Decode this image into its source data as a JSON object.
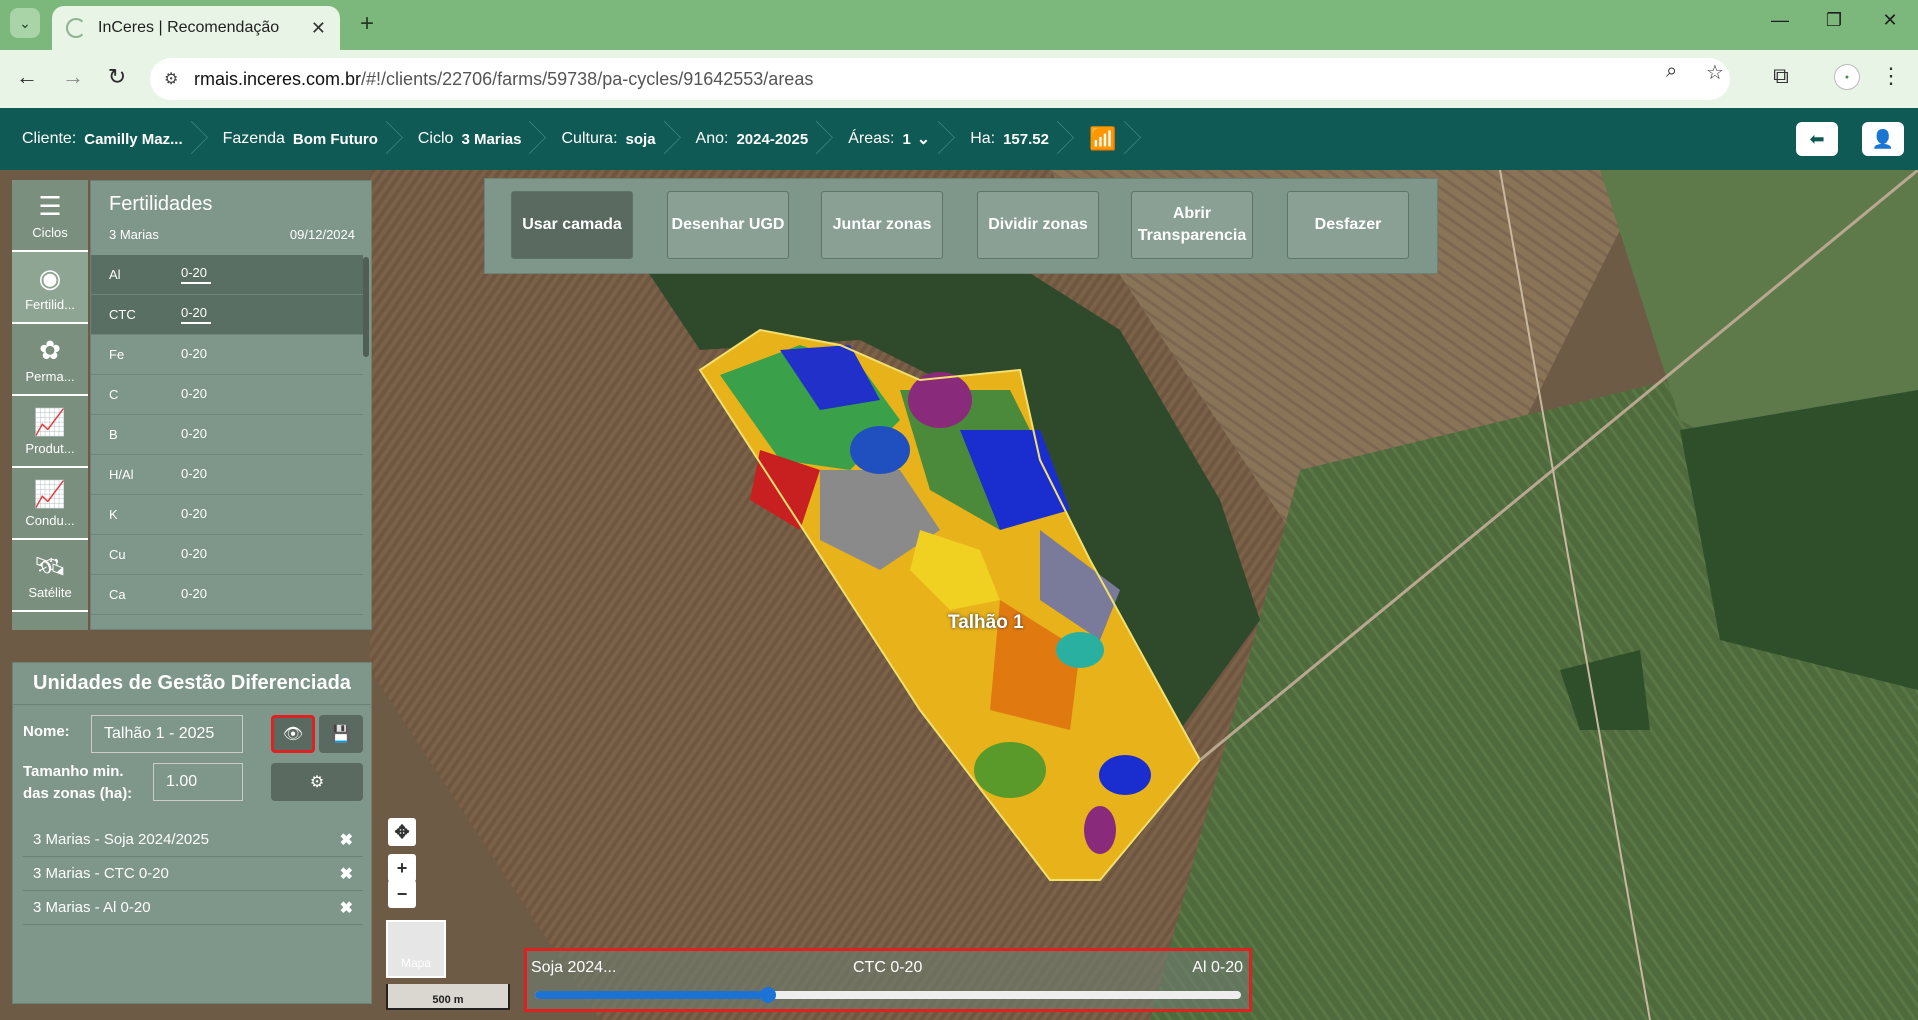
{
  "browser": {
    "tab_title": "InCeres | Recomendação",
    "url_domain": "rmais.inceres.com.br",
    "url_path": "/#!/clients/22706/farms/59738/pa-cycles/91642553/areas"
  },
  "header": {
    "cliente_label": "Cliente:",
    "cliente_value": "Camilly Maz...",
    "fazenda_label": "Fazenda",
    "fazenda_value": "Bom Futuro",
    "ciclo_label": "Ciclo",
    "ciclo_value": "3 Marias",
    "cultura_label": "Cultura:",
    "cultura_value": "soja",
    "ano_label": "Ano:",
    "ano_value": "2024-2025",
    "areas_label": "Áreas:",
    "areas_value": "1",
    "ha_label": "Ha:",
    "ha_value": "157.52"
  },
  "tools": [
    {
      "label": "Ciclos"
    },
    {
      "label": "Fertilid..."
    },
    {
      "label": "Perma..."
    },
    {
      "label": "Produt..."
    },
    {
      "label": "Condu..."
    },
    {
      "label": "Satélite"
    }
  ],
  "fertilidades": {
    "title": "Fertilidades",
    "subtitle": "3 Marias",
    "date": "09/12/2024",
    "rows": [
      {
        "key": "Al",
        "value": "0-20",
        "selected": true
      },
      {
        "key": "CTC",
        "value": "0-20",
        "selected": true
      },
      {
        "key": "Fe",
        "value": "0-20",
        "selected": false
      },
      {
        "key": "C",
        "value": "0-20",
        "selected": false
      },
      {
        "key": "B",
        "value": "0-20",
        "selected": false
      },
      {
        "key": "H/Al",
        "value": "0-20",
        "selected": false
      },
      {
        "key": "K",
        "value": "0-20",
        "selected": false
      },
      {
        "key": "Cu",
        "value": "0-20",
        "selected": false
      },
      {
        "key": "Ca",
        "value": "0-20",
        "selected": false
      }
    ]
  },
  "ugd": {
    "title": "Unidades de Gestão Diferenciada",
    "nome_label": "Nome:",
    "nome_value": "Talhão 1 - 2025",
    "tamanho_label_1": "Tamanho min.",
    "tamanho_label_2": "das zonas (ha):",
    "tamanho_value": "1.00",
    "layers": [
      "3 Marias - Soja 2024/2025",
      "3 Marias - CTC 0-20",
      "3 Marias - Al 0-20"
    ]
  },
  "toolbar": {
    "buttons": [
      "Usar camada",
      "Desenhar UGD",
      "Juntar zonas",
      "Dividir zonas",
      "Abrir Transparencia",
      "Desfazer"
    ]
  },
  "map": {
    "field_label": "Talhão 1",
    "base_layer_label": "Mapa",
    "scale_label": "500 m"
  },
  "slider": {
    "left_label": "Soja 2024...",
    "mid_label": "CTC 0-20",
    "right_label": "Al 0-20",
    "position": 0.33
  }
}
